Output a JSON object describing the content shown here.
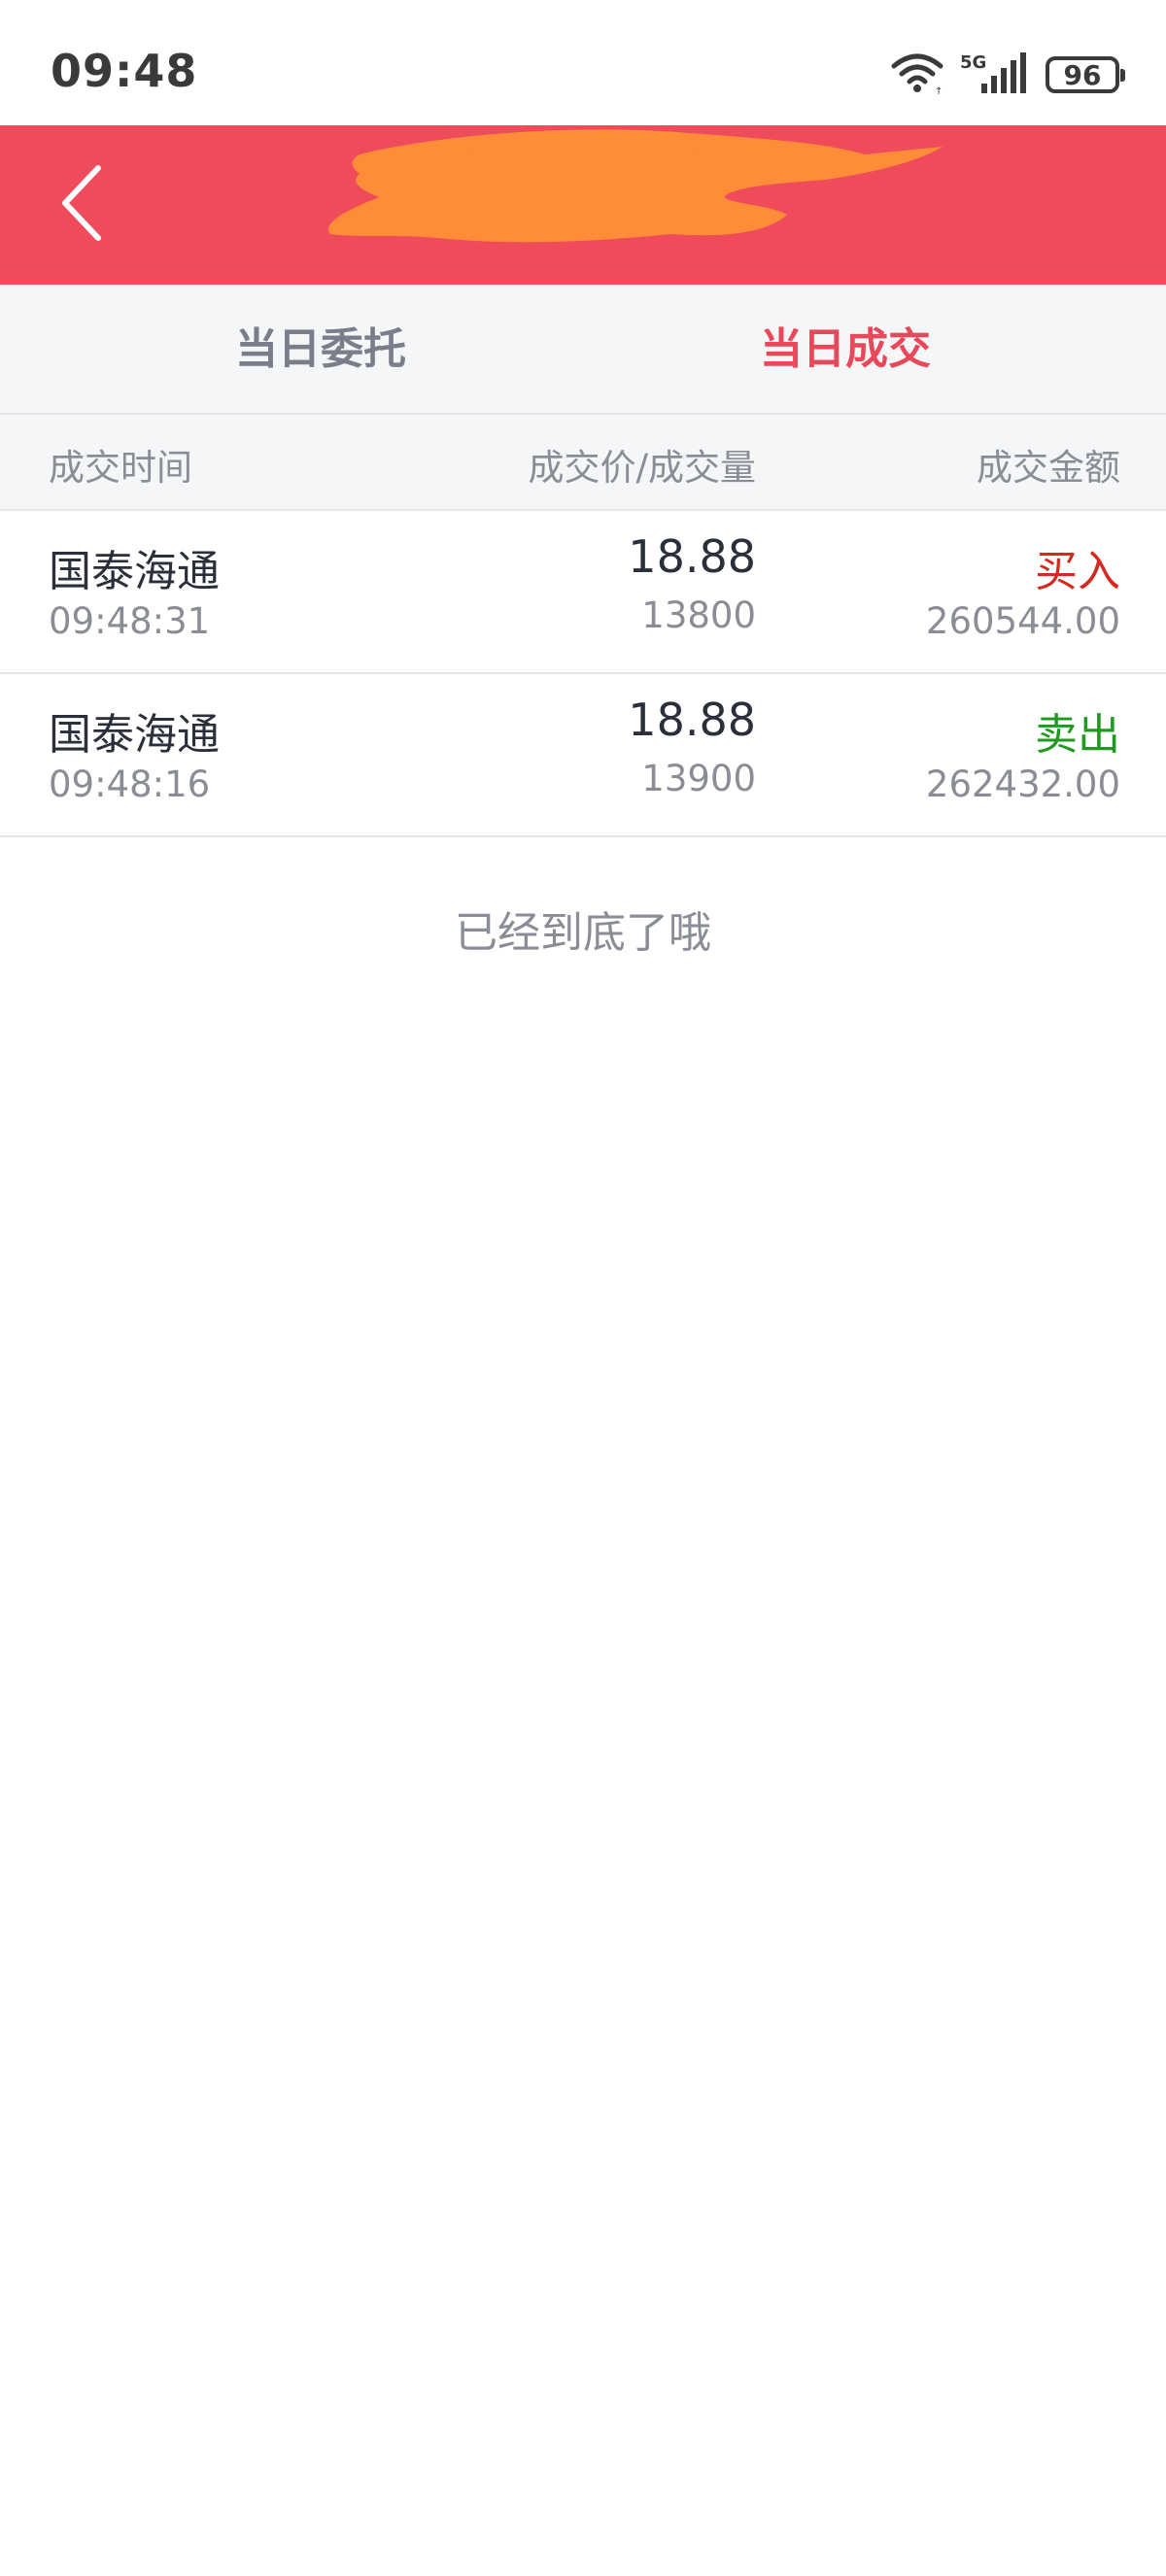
{
  "status_bar": {
    "time": "09:48",
    "network": "5G",
    "battery": "96",
    "icons": [
      "wifi-icon",
      "signal-icon",
      "battery-icon"
    ]
  },
  "header": {
    "back_icon": "chevron-left-icon",
    "background_color": "#ef4b5a"
  },
  "tabs": [
    {
      "label": "当日委托",
      "active": false
    },
    {
      "label": "当日成交",
      "active": true
    }
  ],
  "columns": {
    "time": "成交时间",
    "price_qty": "成交价/成交量",
    "amount": "成交金额"
  },
  "trades": [
    {
      "name": "国泰海通",
      "time": "09:48:31",
      "price": "18.88",
      "quantity": "13800",
      "side": "买入",
      "side_color": "#d42a22",
      "amount": "260544.00"
    },
    {
      "name": "国泰海通",
      "time": "09:48:16",
      "price": "18.88",
      "quantity": "13900",
      "side": "卖出",
      "side_color": "#1f9a1f",
      "amount": "262432.00"
    }
  ],
  "end_note": "已经到底了哦",
  "colors": {
    "accent": "#e8495a",
    "buy": "#d42a22",
    "sell": "#1f9a1f"
  }
}
